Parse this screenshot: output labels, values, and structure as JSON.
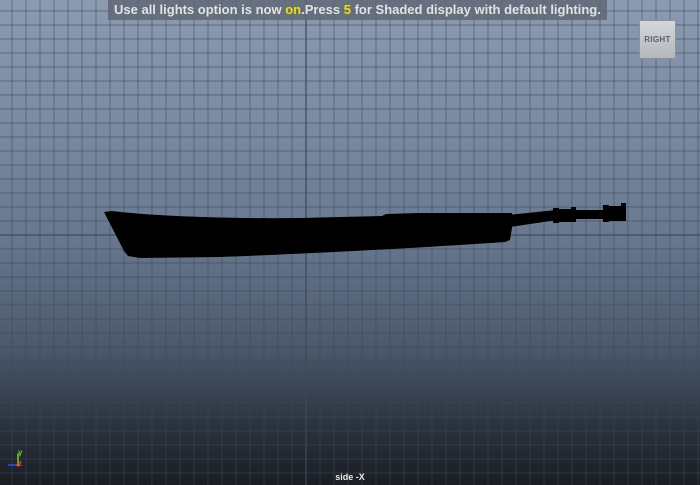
{
  "hud": {
    "msg_part1": "Use all lights option is now ",
    "msg_highlight1": "on",
    "msg_part2": ".Press ",
    "msg_highlight2": "5",
    "msg_part3": " for Shaded display with default lighting."
  },
  "view_cube": {
    "label": "RIGHT"
  },
  "axes": {
    "y_label": "y",
    "z_label": "z"
  },
  "camera": {
    "label": "side -X"
  },
  "colors": {
    "highlight": "#f2e000",
    "grid_line": "#3f4856",
    "axis_y": "#6ccc22",
    "axis_z": "#ff4a1a",
    "axis_x": "#2a4dff",
    "silhouette": "#000000"
  }
}
